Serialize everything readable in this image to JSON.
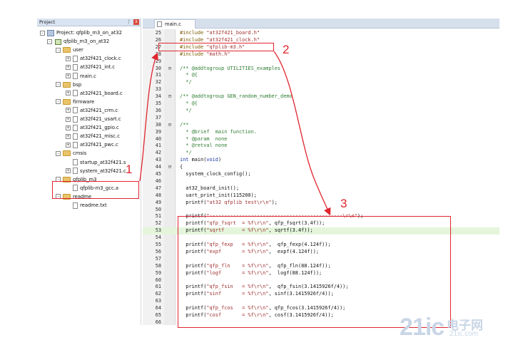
{
  "project_panel": {
    "title": "Project",
    "pin": "p",
    "close": "x",
    "items": [
      {
        "label": "Project: qfplib_m3_on_at32",
        "kind": "project",
        "exp": "−"
      },
      {
        "label": "qfplib_m3_on_at32",
        "kind": "target",
        "exp": "−"
      },
      {
        "label": "user",
        "kind": "folder",
        "exp": "−"
      },
      {
        "label": "at32f421_clock.c",
        "kind": "file",
        "exp": "+"
      },
      {
        "label": "at32f421_int.c",
        "kind": "file",
        "exp": "+"
      },
      {
        "label": "main.c",
        "kind": "file",
        "exp": "+"
      },
      {
        "label": "bsp",
        "kind": "folder",
        "exp": "−"
      },
      {
        "label": "at32f421_board.c",
        "kind": "file",
        "exp": "+"
      },
      {
        "label": "firmware",
        "kind": "folder",
        "exp": "−"
      },
      {
        "label": "at32f421_crm.c",
        "kind": "file",
        "exp": "+"
      },
      {
        "label": "at32f421_usart.c",
        "kind": "file",
        "exp": "+"
      },
      {
        "label": "at32f421_gpio.c",
        "kind": "file",
        "exp": "+"
      },
      {
        "label": "at32f421_misc.c",
        "kind": "file",
        "exp": "+"
      },
      {
        "label": "at32f421_pwc.c",
        "kind": "file",
        "exp": "+"
      },
      {
        "label": "cmsis",
        "kind": "folder",
        "exp": "−"
      },
      {
        "label": "startup_at32f421.s",
        "kind": "file",
        "exp": ""
      },
      {
        "label": "system_at32f421.c",
        "kind": "file",
        "exp": "+"
      },
      {
        "label": "qfplib_m3",
        "kind": "folder",
        "exp": "−"
      },
      {
        "label": "qfplib-m3_gcc.a",
        "kind": "file",
        "exp": ""
      },
      {
        "label": "readme",
        "kind": "folder",
        "exp": "−"
      },
      {
        "label": "readme.txt",
        "kind": "file",
        "exp": ""
      }
    ]
  },
  "editor": {
    "tab_label": "main.c",
    "lines": [
      {
        "n": "25",
        "fold": "",
        "parts": [
          {
            "c": "pp",
            "t": "#include "
          },
          {
            "c": "str",
            "t": "\"at32f421_board.h\""
          }
        ]
      },
      {
        "n": "26",
        "fold": "",
        "parts": [
          {
            "c": "pp",
            "t": "#include "
          },
          {
            "c": "str",
            "t": "\"at32f421_clock.h\""
          }
        ]
      },
      {
        "n": "27",
        "fold": "",
        "parts": [
          {
            "c": "pp",
            "t": "#include "
          },
          {
            "c": "str",
            "t": "\"qfplib-m3.h\""
          }
        ]
      },
      {
        "n": "28",
        "fold": "",
        "parts": [
          {
            "c": "pp",
            "t": "#include "
          },
          {
            "c": "str",
            "t": "\"math.h\""
          }
        ]
      },
      {
        "n": "29",
        "fold": "",
        "parts": []
      },
      {
        "n": "30",
        "fold": "⊟",
        "parts": [
          {
            "c": "cm",
            "t": "/** @addtogroup UTILITIES_examples"
          }
        ]
      },
      {
        "n": "31",
        "fold": "",
        "parts": [
          {
            "c": "cm",
            "t": "  * @{"
          }
        ]
      },
      {
        "n": "32",
        "fold": "",
        "parts": [
          {
            "c": "cm",
            "t": "  */"
          }
        ]
      },
      {
        "n": "33",
        "fold": "",
        "parts": []
      },
      {
        "n": "34",
        "fold": "⊟",
        "parts": [
          {
            "c": "cm",
            "t": "/** @addtogroup GEN_random_number_demo"
          }
        ]
      },
      {
        "n": "35",
        "fold": "",
        "parts": [
          {
            "c": "cm",
            "t": "  * @{"
          }
        ]
      },
      {
        "n": "36",
        "fold": "",
        "parts": [
          {
            "c": "cm",
            "t": "  */"
          }
        ]
      },
      {
        "n": "37",
        "fold": "",
        "parts": []
      },
      {
        "n": "38",
        "fold": "⊟",
        "parts": [
          {
            "c": "cm",
            "t": "/**"
          }
        ]
      },
      {
        "n": "39",
        "fold": "",
        "parts": [
          {
            "c": "cm",
            "t": "  * @brief  main function."
          }
        ]
      },
      {
        "n": "40",
        "fold": "",
        "parts": [
          {
            "c": "cm",
            "t": "  * @param  none"
          }
        ]
      },
      {
        "n": "41",
        "fold": "",
        "parts": [
          {
            "c": "cm",
            "t": "  * @retval none"
          }
        ]
      },
      {
        "n": "42",
        "fold": "",
        "parts": [
          {
            "c": "cm",
            "t": "  */"
          }
        ]
      },
      {
        "n": "43",
        "fold": "",
        "parts": [
          {
            "c": "kw",
            "t": "int"
          },
          {
            "c": "tx",
            "t": " main("
          },
          {
            "c": "kw",
            "t": "void"
          },
          {
            "c": "tx",
            "t": ")"
          }
        ]
      },
      {
        "n": "44",
        "fold": "⊟",
        "parts": [
          {
            "c": "tx",
            "t": "{"
          }
        ]
      },
      {
        "n": "45",
        "fold": "",
        "parts": [
          {
            "c": "tx",
            "t": "  system_clock_config();"
          }
        ]
      },
      {
        "n": "46",
        "fold": "",
        "parts": []
      },
      {
        "n": "47",
        "fold": "",
        "parts": [
          {
            "c": "tx",
            "t": "  at32_board_init();"
          }
        ]
      },
      {
        "n": "48",
        "fold": "",
        "parts": [
          {
            "c": "tx",
            "t": "  uart_print_init(115200);"
          }
        ]
      },
      {
        "n": "49",
        "fold": "",
        "parts": [
          {
            "c": "tx",
            "t": "  printf("
          },
          {
            "c": "str",
            "t": "\"at32 qfplib test\\r\\n\""
          },
          {
            "c": "tx",
            "t": ");"
          }
        ]
      },
      {
        "n": "50",
        "fold": "",
        "parts": []
      },
      {
        "n": "51",
        "fold": "",
        "parts": [
          {
            "c": "tx",
            "t": "  printf("
          },
          {
            "c": "str",
            "t": "\"---------------------------------------------\\r\\n\""
          },
          {
            "c": "tx",
            "t": ");"
          }
        ]
      },
      {
        "n": "52",
        "fold": "",
        "parts": [
          {
            "c": "tx",
            "t": "  printf("
          },
          {
            "c": "str",
            "t": "\"qfp_fsqrt  = %f\\r\\n\""
          },
          {
            "c": "tx",
            "t": ", qfp_fsqrt(3.4f));"
          }
        ]
      },
      {
        "n": "53",
        "fold": "",
        "hl": true,
        "parts": [
          {
            "c": "tx",
            "t": "  printf("
          },
          {
            "c": "str",
            "t": "\"sqrtf      = %f\\r\\n\""
          },
          {
            "c": "tx",
            "t": ", sqrtf(3.4f));"
          }
        ]
      },
      {
        "n": "54",
        "fold": "",
        "parts": []
      },
      {
        "n": "55",
        "fold": "",
        "parts": [
          {
            "c": "tx",
            "t": "  printf("
          },
          {
            "c": "str",
            "t": "\"qfp_fexp   = %f\\r\\n\""
          },
          {
            "c": "tx",
            "t": ",  qfp_fexp(4.124f));"
          }
        ]
      },
      {
        "n": "56",
        "fold": "",
        "parts": [
          {
            "c": "tx",
            "t": "  printf("
          },
          {
            "c": "str",
            "t": "\"expf       = %f\\r\\n\""
          },
          {
            "c": "tx",
            "t": ",  expf(4.124f));"
          }
        ]
      },
      {
        "n": "57",
        "fold": "",
        "parts": []
      },
      {
        "n": "58",
        "fold": "",
        "parts": [
          {
            "c": "tx",
            "t": "  printf("
          },
          {
            "c": "str",
            "t": "\"qfp_fln    = %f\\r\\n\""
          },
          {
            "c": "tx",
            "t": ",  qfp_fln(88.124f));"
          }
        ]
      },
      {
        "n": "59",
        "fold": "",
        "parts": [
          {
            "c": "tx",
            "t": "  printf("
          },
          {
            "c": "str",
            "t": "\"logf       = %f\\r\\n\""
          },
          {
            "c": "tx",
            "t": ",  logf(88.124f));"
          }
        ]
      },
      {
        "n": "60",
        "fold": "",
        "parts": []
      },
      {
        "n": "61",
        "fold": "",
        "parts": [
          {
            "c": "tx",
            "t": "  printf("
          },
          {
            "c": "str",
            "t": "\"qfp_fsin   = %f\\r\\n\""
          },
          {
            "c": "tx",
            "t": ",  qfp_fsin(3.1415926f/4));"
          }
        ]
      },
      {
        "n": "62",
        "fold": "",
        "parts": [
          {
            "c": "tx",
            "t": "  printf("
          },
          {
            "c": "str",
            "t": "\"sinf       = %f\\r\\n\""
          },
          {
            "c": "tx",
            "t": ", sinf(3.1415926f/4));"
          }
        ]
      },
      {
        "n": "63",
        "fold": "",
        "parts": []
      },
      {
        "n": "64",
        "fold": "",
        "parts": [
          {
            "c": "tx",
            "t": "  printf("
          },
          {
            "c": "str",
            "t": "\"qfp_fcos   = %f\\r\\n\""
          },
          {
            "c": "tx",
            "t": ", qfp_fcos(3.1415926f/4));"
          }
        ]
      },
      {
        "n": "65",
        "fold": "",
        "parts": [
          {
            "c": "tx",
            "t": "  printf("
          },
          {
            "c": "str",
            "t": "\"cosf       = %f\\r\\n\""
          },
          {
            "c": "tx",
            "t": ", cosf(3.1415926f/4));"
          }
        ]
      },
      {
        "n": "66",
        "fold": "",
        "parts": []
      }
    ]
  },
  "annotations": {
    "label_1": "1",
    "label_2": "2",
    "label_3": "3",
    "color": "#e0252e"
  },
  "watermark": {
    "big": "21ic",
    "cn": "电子网",
    "small": "21ic.com"
  }
}
